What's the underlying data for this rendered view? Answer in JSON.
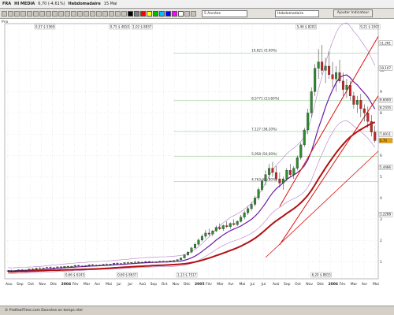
{
  "title": {
    "ticker": "FRA",
    "name": "HI MEDIA",
    "price": "6,70 (-4,61%)",
    "period": "Hebdomadaire",
    "date": "15 Mai"
  },
  "toolbar": {
    "period_select": "5 Années",
    "interval_select": "Hebdomadaire",
    "add_indicator_button": "Ajouter Indicateur"
  },
  "side_label": "Prix",
  "status": {
    "text": "© ProRealTime.com  Données en temps réel"
  },
  "colors": {
    "grid": "#dcdcdc",
    "candle_up": "#2e8b2e",
    "candle_down": "#cc2222",
    "channel": "#dd1111",
    "ma_purple": "#6a1aa8",
    "ma_thick": "#b01010",
    "bollinger": "#b080c8",
    "price_label_bg": "#ffffff",
    "current_price_tag": "#f0a000"
  },
  "chart_data": {
    "type": "candlestick",
    "x_labels": [
      "Aou",
      "Sep",
      "Oct",
      "Nov",
      "Déc",
      "2004",
      "Fév",
      "Mar",
      "Avr",
      "Mai",
      "Jui",
      "Jul",
      "Aoû",
      "Sep",
      "Oct",
      "Nov",
      "Déc",
      "2005",
      "Fév",
      "Mar",
      "Avr",
      "Mai",
      "Jui",
      "Jul",
      "Aoû",
      "Sep",
      "Oct",
      "Nov",
      "Déc",
      "2006",
      "Fév",
      "Mar",
      "Avr",
      "Mai"
    ],
    "y_ticks": [
      "10",
      "9",
      "8",
      "7",
      "6",
      "5",
      "4",
      "3",
      "2",
      "1"
    ],
    "ylim": [
      0.2,
      12.2
    ],
    "fib_levels": [
      {
        "label": "10,821 (0,00%)",
        "value": 10.821
      },
      {
        "label": "8,5771 (23,60%)",
        "value": 8.5771
      },
      {
        "label": "7,127 (38,20%)",
        "value": 7.127
      },
      {
        "label": "5,958 (50,00%)",
        "value": 5.958
      },
      {
        "label": "4,763 (61,80%)",
        "value": 4.763
      }
    ],
    "top_labels": [
      "0,57 $ 5569",
      "0,75 $ 4810",
      "1,02 $ 8837",
      "5,46 $ 8202",
      "9,21 $ 1002"
    ],
    "bottom_labels": [
      "0,66 $ 6245",
      "0,69 $ 8637",
      "1,13 $ 7517",
      "6,20 $ 8815"
    ],
    "right_tags": [
      "11,281",
      "10,107",
      "8,6000",
      "8,2335",
      "7,0011",
      "6,70",
      "5,4486",
      "3,2288"
    ],
    "candles": [
      [
        0.55,
        0.6,
        0.5,
        0.58
      ],
      [
        0.58,
        0.62,
        0.54,
        0.56
      ],
      [
        0.56,
        0.6,
        0.52,
        0.59
      ],
      [
        0.59,
        0.64,
        0.57,
        0.62
      ],
      [
        0.62,
        0.66,
        0.58,
        0.6
      ],
      [
        0.6,
        0.63,
        0.57,
        0.61
      ],
      [
        0.61,
        0.68,
        0.6,
        0.66
      ],
      [
        0.66,
        0.7,
        0.62,
        0.64
      ],
      [
        0.64,
        0.72,
        0.63,
        0.7
      ],
      [
        0.7,
        0.74,
        0.66,
        0.68
      ],
      [
        0.68,
        0.72,
        0.64,
        0.71
      ],
      [
        0.71,
        0.76,
        0.69,
        0.74
      ],
      [
        0.74,
        0.78,
        0.7,
        0.72
      ],
      [
        0.72,
        0.75,
        0.68,
        0.7
      ],
      [
        0.7,
        0.77,
        0.69,
        0.76
      ],
      [
        0.76,
        0.8,
        0.72,
        0.74
      ],
      [
        0.74,
        0.79,
        0.71,
        0.78
      ],
      [
        0.78,
        0.82,
        0.75,
        0.76
      ],
      [
        0.76,
        0.8,
        0.73,
        0.79
      ],
      [
        0.79,
        0.85,
        0.77,
        0.83
      ],
      [
        0.83,
        0.86,
        0.78,
        0.8
      ],
      [
        0.8,
        0.83,
        0.76,
        0.78
      ],
      [
        0.78,
        0.84,
        0.77,
        0.82
      ],
      [
        0.82,
        0.88,
        0.8,
        0.86
      ],
      [
        0.86,
        0.9,
        0.82,
        0.84
      ],
      [
        0.84,
        0.87,
        0.8,
        0.82
      ],
      [
        0.82,
        0.86,
        0.79,
        0.85
      ],
      [
        0.85,
        0.9,
        0.83,
        0.88
      ],
      [
        0.88,
        0.92,
        0.84,
        0.86
      ],
      [
        0.86,
        0.9,
        0.82,
        0.89
      ],
      [
        0.89,
        0.95,
        0.87,
        0.93
      ],
      [
        0.93,
        0.97,
        0.88,
        0.9
      ],
      [
        0.9,
        0.94,
        0.86,
        0.92
      ],
      [
        0.92,
        0.98,
        0.9,
        0.96
      ],
      [
        0.96,
        1.0,
        0.92,
        0.94
      ],
      [
        0.94,
        0.98,
        0.9,
        0.97
      ],
      [
        0.97,
        1.02,
        0.95,
        0.99
      ],
      [
        0.99,
        1.03,
        0.94,
        0.96
      ],
      [
        0.96,
        1.0,
        0.92,
        0.98
      ],
      [
        0.98,
        1.03,
        0.96,
        1.01
      ],
      [
        1.01,
        1.05,
        0.97,
        0.99
      ],
      [
        0.99,
        1.02,
        0.95,
        0.97
      ],
      [
        0.97,
        1.01,
        0.94,
        1.0
      ],
      [
        1.0,
        1.04,
        0.97,
        1.02
      ],
      [
        1.02,
        1.05,
        0.98,
        1.0
      ],
      [
        1.0,
        1.03,
        0.96,
        1.02
      ],
      [
        1.02,
        1.06,
        1.0,
        1.04
      ],
      [
        1.04,
        1.08,
        1.01,
        1.06
      ],
      [
        1.06,
        1.12,
        1.04,
        1.1
      ],
      [
        1.1,
        1.2,
        1.08,
        1.18
      ],
      [
        1.18,
        1.35,
        1.15,
        1.32
      ],
      [
        1.32,
        1.5,
        1.28,
        1.45
      ],
      [
        1.45,
        1.7,
        1.4,
        1.65
      ],
      [
        1.65,
        1.9,
        1.6,
        1.82
      ],
      [
        1.82,
        2.1,
        1.75,
        2.02
      ],
      [
        2.02,
        2.3,
        1.95,
        2.2
      ],
      [
        2.2,
        2.5,
        2.1,
        2.35
      ],
      [
        2.35,
        2.55,
        2.2,
        2.3
      ],
      [
        2.3,
        2.5,
        2.2,
        2.45
      ],
      [
        2.45,
        2.7,
        2.4,
        2.62
      ],
      [
        2.62,
        2.8,
        2.5,
        2.55
      ],
      [
        2.55,
        2.75,
        2.45,
        2.7
      ],
      [
        2.7,
        2.9,
        2.6,
        2.65
      ],
      [
        2.65,
        2.85,
        2.55,
        2.8
      ],
      [
        2.8,
        3.0,
        2.7,
        2.75
      ],
      [
        2.75,
        2.95,
        2.68,
        2.9
      ],
      [
        2.9,
        3.2,
        2.85,
        3.1
      ],
      [
        3.1,
        3.4,
        3.0,
        3.3
      ],
      [
        3.3,
        3.6,
        3.2,
        3.5
      ],
      [
        3.5,
        3.8,
        3.4,
        3.7
      ],
      [
        3.7,
        4.1,
        3.6,
        4.0
      ],
      [
        4.0,
        4.5,
        3.9,
        4.4
      ],
      [
        4.4,
        4.9,
        4.3,
        4.8
      ],
      [
        4.8,
        5.3,
        4.6,
        5.1
      ],
      [
        5.1,
        5.6,
        4.9,
        5.4
      ],
      [
        5.4,
        5.7,
        5.0,
        5.2
      ],
      [
        5.2,
        5.5,
        4.8,
        4.9
      ],
      [
        4.9,
        5.2,
        4.5,
        4.7
      ],
      [
        4.7,
        5.0,
        4.4,
        4.9
      ],
      [
        4.9,
        5.4,
        4.8,
        5.3
      ],
      [
        5.3,
        5.6,
        5.0,
        5.1
      ],
      [
        5.1,
        5.5,
        4.9,
        5.4
      ],
      [
        5.4,
        6.0,
        5.3,
        5.9
      ],
      [
        5.9,
        6.6,
        5.8,
        6.5
      ],
      [
        6.5,
        7.3,
        6.4,
        7.2
      ],
      [
        7.2,
        8.2,
        7.0,
        8.0
      ],
      [
        8.0,
        9.2,
        7.8,
        9.0
      ],
      [
        9.0,
        10.3,
        8.8,
        10.1
      ],
      [
        10.1,
        11.0,
        9.6,
        10.4
      ],
      [
        10.4,
        11.2,
        9.8,
        10.0
      ],
      [
        10.0,
        10.6,
        9.4,
        10.2
      ],
      [
        10.2,
        10.9,
        9.6,
        9.8
      ],
      [
        9.8,
        10.4,
        9.2,
        9.6
      ],
      [
        9.6,
        10.2,
        9.0,
        9.9
      ],
      [
        9.9,
        10.5,
        9.4,
        9.5
      ],
      [
        9.5,
        9.9,
        8.8,
        9.1
      ],
      [
        9.1,
        9.6,
        8.7,
        9.3
      ],
      [
        9.3,
        9.5,
        8.6,
        8.8
      ],
      [
        8.8,
        9.0,
        8.2,
        8.4
      ],
      [
        8.4,
        8.8,
        8.0,
        8.6
      ],
      [
        8.6,
        8.9,
        7.8,
        8.2
      ],
      [
        8.2,
        8.4,
        7.6,
        8.0
      ],
      [
        8.0,
        8.3,
        7.3,
        7.6
      ],
      [
        7.6,
        7.9,
        6.9,
        7.1
      ],
      [
        7.1,
        7.4,
        6.6,
        6.7
      ]
    ]
  }
}
